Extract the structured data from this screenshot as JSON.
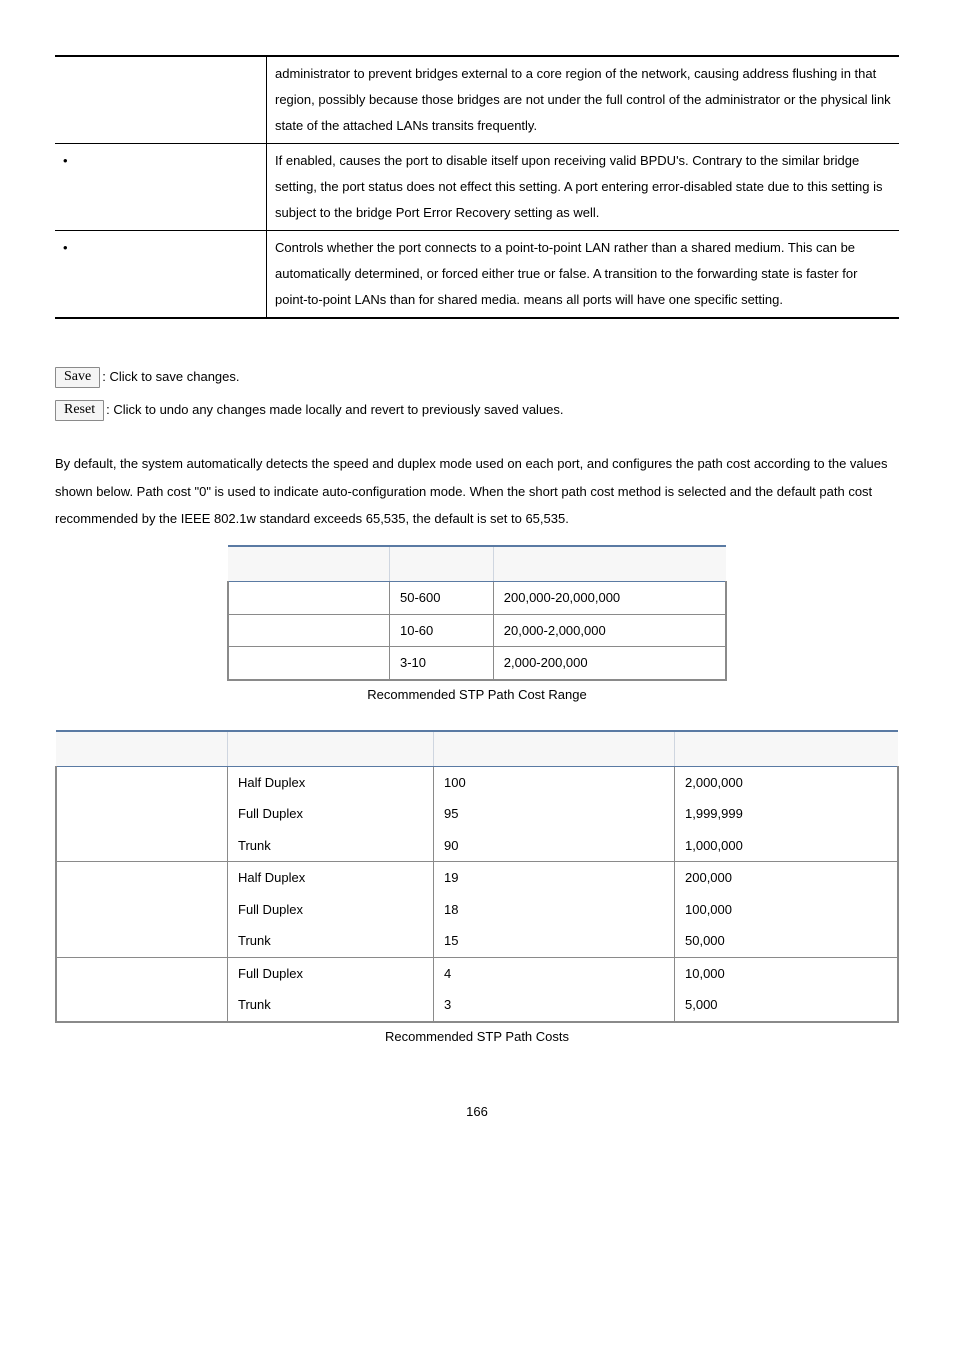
{
  "desc_table": {
    "rows": [
      {
        "label": "",
        "text": "administrator to prevent bridges external to a core region of the network, causing address flushing in that region, possibly because those bridges are not under the full control of the administrator or the physical link state of the attached LANs transits frequently."
      },
      {
        "label": "•",
        "text": "If enabled, causes the port to disable itself upon receiving valid BPDU's. Contrary to the similar bridge setting, the port        status does not effect this setting. A port entering error-disabled state due to this setting is subject to the bridge Port Error Recovery setting as well."
      },
      {
        "label": "•",
        "text": "Controls whether the port connects to a point-to-point LAN rather than a shared medium. This can be automatically determined, or forced either true or false. A transition to the forwarding state is faster for point-to-point LANs than for shared media.        means all ports will have one specific setting."
      }
    ]
  },
  "buttons": {
    "save": {
      "chip": "Save",
      "desc": ": Click to save changes."
    },
    "reset": {
      "chip": "Reset",
      "desc": ": Click to undo any changes made locally and revert to previously saved values."
    }
  },
  "paragraph": "By default, the system automatically detects the speed and duplex mode used on each port, and configures the path cost according to the values shown below. Path cost \"0\" is used to indicate auto-configuration mode. When the short path cost method is selected and the default path cost recommended by the IEEE 802.1w standard exceeds 65,535, the default is set to 65,535.",
  "range_table": {
    "headers": [
      "",
      "",
      ""
    ],
    "rows": [
      [
        "",
        "50-600",
        "200,000-20,000,000"
      ],
      [
        "",
        "10-60",
        "20,000-2,000,000"
      ],
      [
        "",
        "3-10",
        "2,000-200,000"
      ]
    ],
    "caption": "Recommended STP Path Cost Range"
  },
  "costs_table": {
    "headers": [
      "",
      "",
      "",
      ""
    ],
    "groups": [
      {
        "rows": [
          [
            "",
            "Half Duplex",
            "100",
            "2,000,000"
          ],
          [
            "",
            "Full Duplex",
            "95",
            "1,999,999"
          ],
          [
            "",
            "Trunk",
            "90",
            "1,000,000"
          ]
        ]
      },
      {
        "rows": [
          [
            "",
            "Half Duplex",
            "19",
            "200,000"
          ],
          [
            "",
            "Full Duplex",
            "18",
            "100,000"
          ],
          [
            "",
            "Trunk",
            "15",
            "50,000"
          ]
        ]
      },
      {
        "rows": [
          [
            "",
            "Full Duplex",
            "4",
            "10,000"
          ],
          [
            "",
            "Trunk",
            "3",
            "5,000"
          ]
        ]
      }
    ],
    "caption": "Recommended STP Path Costs"
  },
  "page_number": "166"
}
